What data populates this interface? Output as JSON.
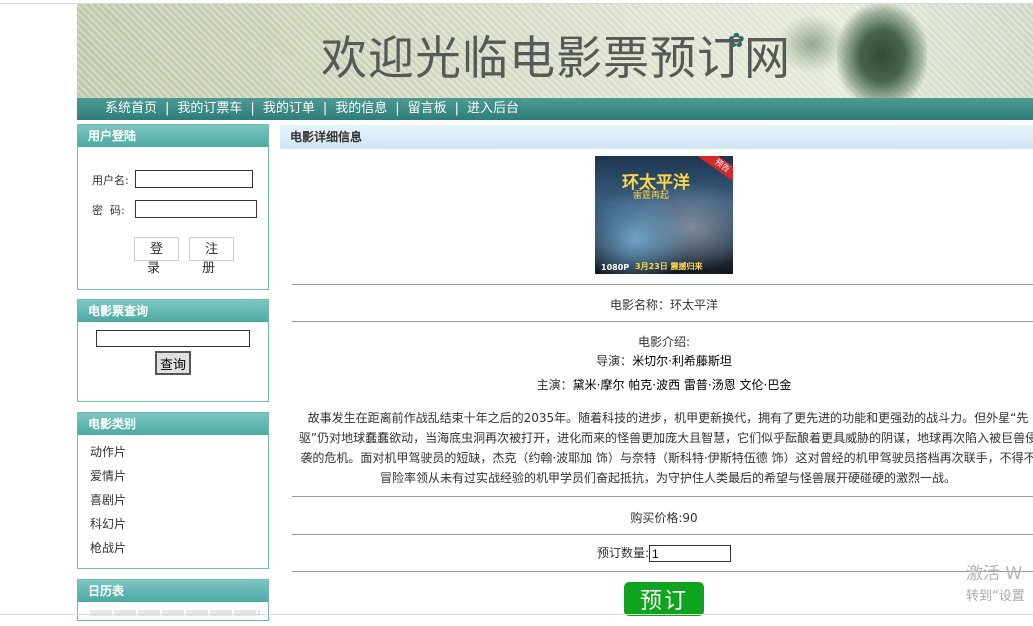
{
  "banner": {
    "title": "欢迎光临电影票预订网"
  },
  "nav": {
    "items": [
      "系统首页",
      "我的订票车",
      "我的订单",
      "我的信息",
      "留言板",
      "进入后台"
    ],
    "separator": "|"
  },
  "login": {
    "title": "用户登陆",
    "username_label": "用户名:",
    "password_label": "密  码:",
    "login_button": "登录",
    "register_button": "注册"
  },
  "search": {
    "title": "电影票查询",
    "button": "查询"
  },
  "categories": {
    "title": "电影类别",
    "items": [
      "动作片",
      "爱情片",
      "喜剧片",
      "科幻片",
      "枪战片"
    ]
  },
  "calendar": {
    "title": "日历表"
  },
  "detail": {
    "header": "电影详细信息",
    "poster": {
      "title": "环太平洋",
      "subtitle": "雷霆再起",
      "ribbon": "预告",
      "quality": "1080P",
      "date": "3月23日 震撼归来"
    },
    "name_line": "电影名称：环太平洋",
    "intro_label": "电影介绍:",
    "director_label": "导演：",
    "director": "米切尔·利希藤斯坦",
    "cast_label": "主演：",
    "cast": "黛米·摩尔 帕克·波西 雷普·汤恩 文伦·巴金",
    "description": "故事发生在距离前作战乱结束十年之后的2035年。随着科技的进步，机甲更新换代，拥有了更先进的功能和更强劲的战斗力。但外星“先驱”仍对地球蠢蠢欲动，当海底虫洞再次被打开，进化而来的怪兽更加庞大且智慧，它们似乎酝酿着更具威胁的阴谋，地球再次陷入被巨兽侵袭的危机。面对机甲驾驶员的短缺，杰克（约翰·波耶加 饰）与奈特（斯科特·伊斯特伍德 饰）这对曾经的机甲驾驶员搭档再次联手，不得不冒险率领从未有过实战经验的机甲学员们奋起抵抗，为守护住人类最后的希望与怪兽展开硬碰硬的激烈一战。",
    "price_line": "购买价格:90",
    "quantity_label": "预订数量:",
    "quantity_value": "1",
    "order_button": "预订"
  },
  "watermark": {
    "line1": "激活 W",
    "line2": "转到“设置"
  }
}
